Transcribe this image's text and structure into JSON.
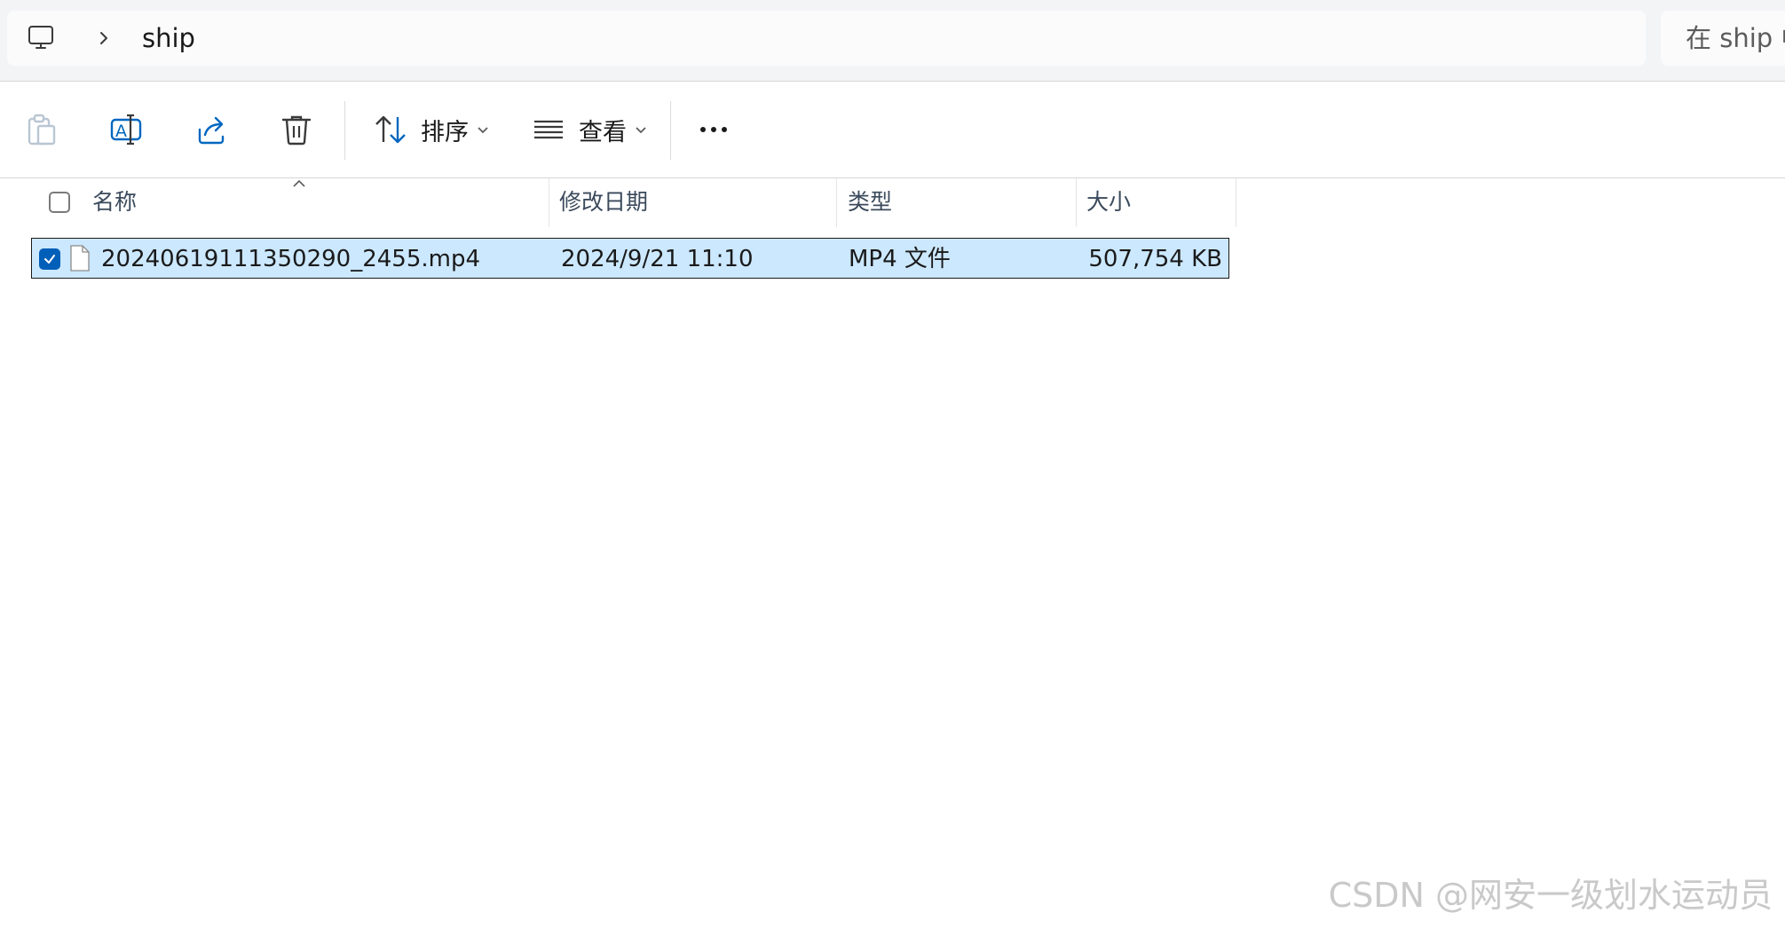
{
  "address_bar": {
    "breadcrumb": "ship"
  },
  "search": {
    "placeholder": "在 ship 中"
  },
  "commands": {
    "sort_label": "排序",
    "view_label": "查看"
  },
  "columns": {
    "name": "名称",
    "modified": "修改日期",
    "type": "类型",
    "size": "大小"
  },
  "files": [
    {
      "name": "20240619111350290_2455.mp4",
      "modified": "2024/9/21 11:10",
      "type": "MP4 文件",
      "size": "507,754 KB",
      "selected": true
    }
  ],
  "watermark": "CSDN @网安一级划水运动员",
  "colors": {
    "selection_bg": "#cce8ff",
    "checkbox_checked": "#005fb8",
    "accent_icon": "#0067c0"
  }
}
